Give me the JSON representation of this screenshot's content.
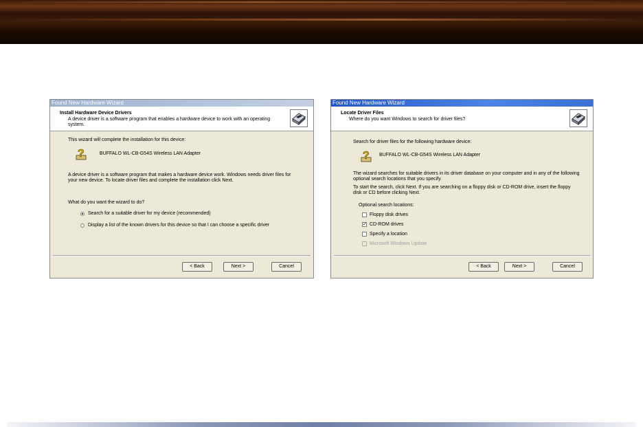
{
  "dialog1": {
    "title": "Found New Hardware Wizard",
    "header_title": "Install Hardware Device Drivers",
    "header_subtitle": "A device driver is a software program that enables a hardware device to work with an operating system.",
    "intro": "This wizard will complete the installation for this device:",
    "device_name": "BUFFALO WL-CB-G54S Wireless LAN Adapter",
    "description": "A device driver is a software program that makes a hardware device work. Windows needs driver files for your new device. To locate driver files and complete the installation click Next.",
    "question": "What do you want the wizard to do?",
    "option1": "Search for a suitable driver for my device (recommended)",
    "option1_selected": true,
    "option2": "Display a list of the known drivers for this device so that I can choose a specific driver",
    "option2_selected": false,
    "back_label": "< Back",
    "next_label": "Next >",
    "cancel_label": "Cancel"
  },
  "dialog2": {
    "title": "Found New Hardware Wizard",
    "header_title": "Locate Driver Files",
    "header_subtitle": "Where do you want Windows to search for driver files?",
    "intro": "Search for driver files for the following hardware device:",
    "device_name": "BUFFALO WL-CB-G54S Wireless LAN Adapter",
    "description": "The wizard searches for suitable drivers in its driver database on your computer and in any of the following optional search locations that you specify.",
    "instruction": "To start the search, click Next. If you are searching on a floppy disk or CD-ROM drive, insert the floppy disk or CD before clicking Next.",
    "optional_label": "Optional search locations:",
    "locations": [
      {
        "label": "Floppy disk drives",
        "checked": false,
        "disabled": false
      },
      {
        "label": "CD-ROM drives",
        "checked": true,
        "disabled": false
      },
      {
        "label": "Specify a location",
        "checked": false,
        "disabled": false
      },
      {
        "label": "Microsoft Windows Update",
        "checked": false,
        "disabled": true
      }
    ],
    "back_label": "< Back",
    "next_label": "Next >",
    "cancel_label": "Cancel"
  }
}
